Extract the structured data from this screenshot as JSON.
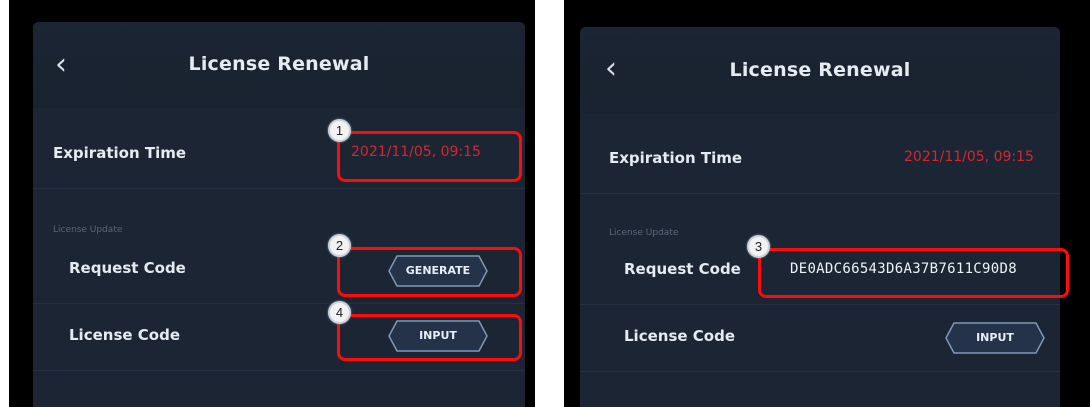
{
  "left": {
    "title": "License Renewal",
    "back_icon": "chevron-left-icon",
    "expiration": {
      "label": "Expiration Time",
      "value": "2021/11/05, 09:15"
    },
    "section_label": "License Update",
    "request_code": {
      "label": "Request Code",
      "button": "GENERATE"
    },
    "license_code": {
      "label": "License Code",
      "button": "INPUT"
    },
    "callouts": [
      "1",
      "2",
      "4"
    ]
  },
  "right": {
    "title": "License Renewal",
    "back_icon": "chevron-left-icon",
    "expiration": {
      "label": "Expiration Time",
      "value": "2021/11/05, 09:15"
    },
    "section_label": "License Update",
    "request_code": {
      "label": "Request Code",
      "value": "DE0ADC66543D6A37B7611C90D8"
    },
    "license_code": {
      "label": "License Code",
      "button": "INPUT"
    },
    "callouts": [
      "3"
    ]
  },
  "colors": {
    "panel_bg": "#1b2533",
    "accent_red": "#d7262e",
    "callout_red": "#ff0b0b",
    "button_outline": "#7f98b7"
  }
}
